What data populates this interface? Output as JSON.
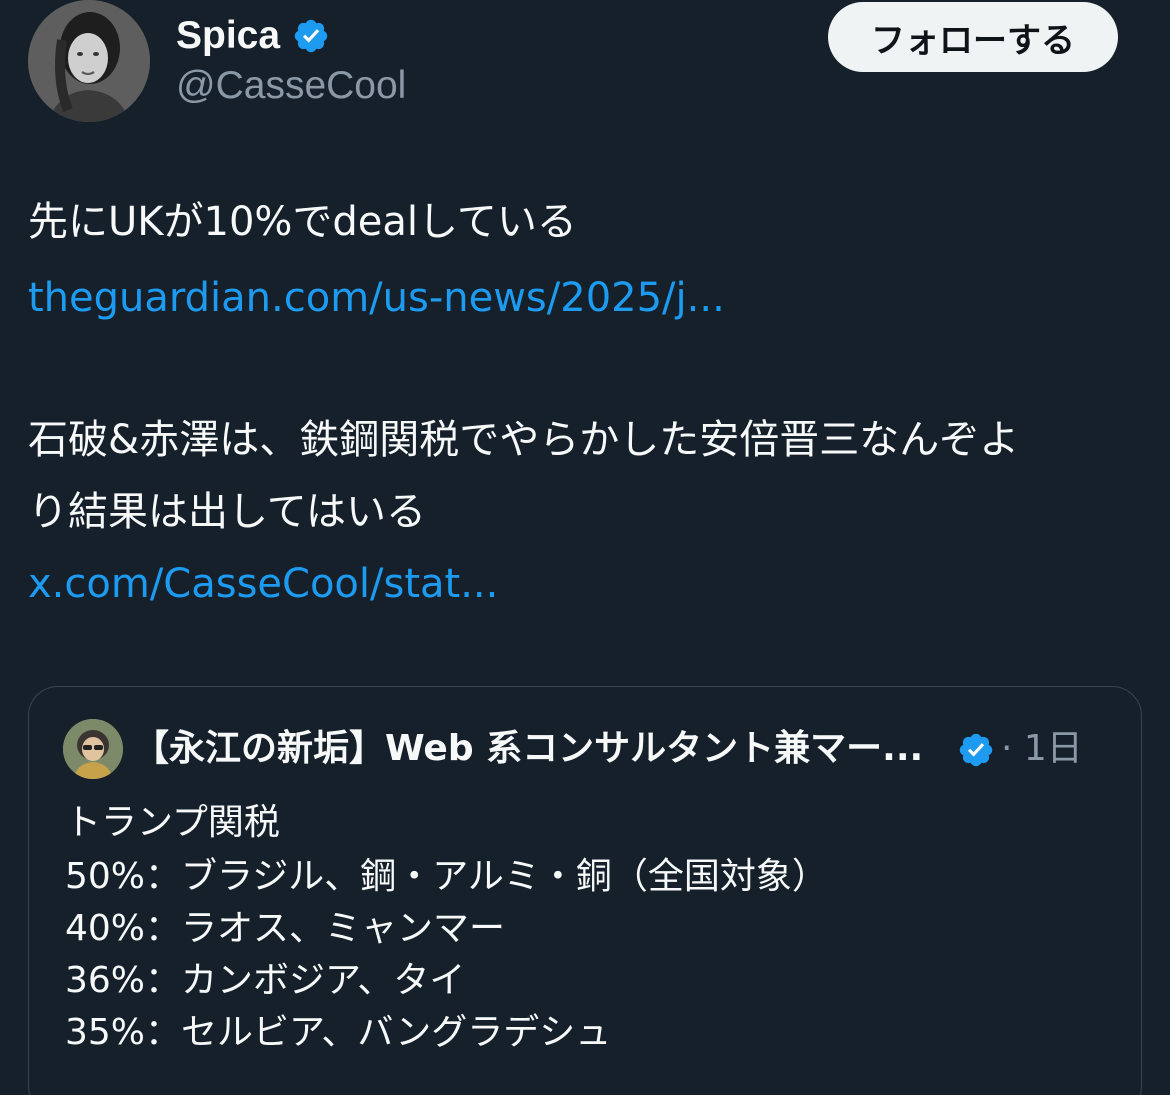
{
  "author": {
    "display_name": "Spica",
    "handle": "@CasseCool",
    "follow_label": "フォローする"
  },
  "tweet": {
    "line1": "先にUKが10%でdealしている",
    "link1": "theguardian.com/us-news/2025/j...",
    "line2": "石破&赤澤は、鉄鋼関税でやらかした安倍晋三なんぞよ",
    "line3": "り結果は出してはいる",
    "link2": "x.com/CasseCool/stat..."
  },
  "quote": {
    "author_name": "【永江の新垢】Web 系コンサルタント兼マー...",
    "time": "· 1日",
    "lines": [
      "トランプ関税",
      "50%：ブラジル、鋼・アルミ・銅（全国対象）",
      "40%：ラオス、ミャンマー",
      "36%：カンボジア、タイ",
      "35%：セルビア、バングラデシュ"
    ]
  },
  "colors": {
    "background": "#15202b",
    "link": "#1d9bf0",
    "verified": "#1d9bf0",
    "secondary_text": "#8b98a5"
  },
  "icons": {
    "verified": "verified-badge-icon"
  }
}
